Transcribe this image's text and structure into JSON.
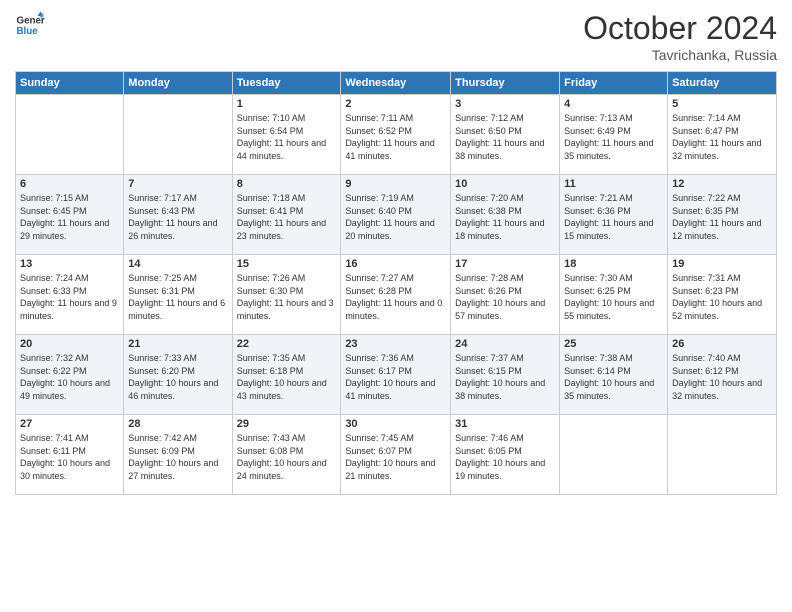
{
  "logo": {
    "line1": "General",
    "line2": "Blue"
  },
  "title": "October 2024",
  "subtitle": "Tavrichanka, Russia",
  "days_of_week": [
    "Sunday",
    "Monday",
    "Tuesday",
    "Wednesday",
    "Thursday",
    "Friday",
    "Saturday"
  ],
  "weeks": [
    [
      {
        "day": "",
        "sunrise": "",
        "sunset": "",
        "daylight": ""
      },
      {
        "day": "",
        "sunrise": "",
        "sunset": "",
        "daylight": ""
      },
      {
        "day": "1",
        "sunrise": "Sunrise: 7:10 AM",
        "sunset": "Sunset: 6:54 PM",
        "daylight": "Daylight: 11 hours and 44 minutes."
      },
      {
        "day": "2",
        "sunrise": "Sunrise: 7:11 AM",
        "sunset": "Sunset: 6:52 PM",
        "daylight": "Daylight: 11 hours and 41 minutes."
      },
      {
        "day": "3",
        "sunrise": "Sunrise: 7:12 AM",
        "sunset": "Sunset: 6:50 PM",
        "daylight": "Daylight: 11 hours and 38 minutes."
      },
      {
        "day": "4",
        "sunrise": "Sunrise: 7:13 AM",
        "sunset": "Sunset: 6:49 PM",
        "daylight": "Daylight: 11 hours and 35 minutes."
      },
      {
        "day": "5",
        "sunrise": "Sunrise: 7:14 AM",
        "sunset": "Sunset: 6:47 PM",
        "daylight": "Daylight: 11 hours and 32 minutes."
      }
    ],
    [
      {
        "day": "6",
        "sunrise": "Sunrise: 7:15 AM",
        "sunset": "Sunset: 6:45 PM",
        "daylight": "Daylight: 11 hours and 29 minutes."
      },
      {
        "day": "7",
        "sunrise": "Sunrise: 7:17 AM",
        "sunset": "Sunset: 6:43 PM",
        "daylight": "Daylight: 11 hours and 26 minutes."
      },
      {
        "day": "8",
        "sunrise": "Sunrise: 7:18 AM",
        "sunset": "Sunset: 6:41 PM",
        "daylight": "Daylight: 11 hours and 23 minutes."
      },
      {
        "day": "9",
        "sunrise": "Sunrise: 7:19 AM",
        "sunset": "Sunset: 6:40 PM",
        "daylight": "Daylight: 11 hours and 20 minutes."
      },
      {
        "day": "10",
        "sunrise": "Sunrise: 7:20 AM",
        "sunset": "Sunset: 6:38 PM",
        "daylight": "Daylight: 11 hours and 18 minutes."
      },
      {
        "day": "11",
        "sunrise": "Sunrise: 7:21 AM",
        "sunset": "Sunset: 6:36 PM",
        "daylight": "Daylight: 11 hours and 15 minutes."
      },
      {
        "day": "12",
        "sunrise": "Sunrise: 7:22 AM",
        "sunset": "Sunset: 6:35 PM",
        "daylight": "Daylight: 11 hours and 12 minutes."
      }
    ],
    [
      {
        "day": "13",
        "sunrise": "Sunrise: 7:24 AM",
        "sunset": "Sunset: 6:33 PM",
        "daylight": "Daylight: 11 hours and 9 minutes."
      },
      {
        "day": "14",
        "sunrise": "Sunrise: 7:25 AM",
        "sunset": "Sunset: 6:31 PM",
        "daylight": "Daylight: 11 hours and 6 minutes."
      },
      {
        "day": "15",
        "sunrise": "Sunrise: 7:26 AM",
        "sunset": "Sunset: 6:30 PM",
        "daylight": "Daylight: 11 hours and 3 minutes."
      },
      {
        "day": "16",
        "sunrise": "Sunrise: 7:27 AM",
        "sunset": "Sunset: 6:28 PM",
        "daylight": "Daylight: 11 hours and 0 minutes."
      },
      {
        "day": "17",
        "sunrise": "Sunrise: 7:28 AM",
        "sunset": "Sunset: 6:26 PM",
        "daylight": "Daylight: 10 hours and 57 minutes."
      },
      {
        "day": "18",
        "sunrise": "Sunrise: 7:30 AM",
        "sunset": "Sunset: 6:25 PM",
        "daylight": "Daylight: 10 hours and 55 minutes."
      },
      {
        "day": "19",
        "sunrise": "Sunrise: 7:31 AM",
        "sunset": "Sunset: 6:23 PM",
        "daylight": "Daylight: 10 hours and 52 minutes."
      }
    ],
    [
      {
        "day": "20",
        "sunrise": "Sunrise: 7:32 AM",
        "sunset": "Sunset: 6:22 PM",
        "daylight": "Daylight: 10 hours and 49 minutes."
      },
      {
        "day": "21",
        "sunrise": "Sunrise: 7:33 AM",
        "sunset": "Sunset: 6:20 PM",
        "daylight": "Daylight: 10 hours and 46 minutes."
      },
      {
        "day": "22",
        "sunrise": "Sunrise: 7:35 AM",
        "sunset": "Sunset: 6:18 PM",
        "daylight": "Daylight: 10 hours and 43 minutes."
      },
      {
        "day": "23",
        "sunrise": "Sunrise: 7:36 AM",
        "sunset": "Sunset: 6:17 PM",
        "daylight": "Daylight: 10 hours and 41 minutes."
      },
      {
        "day": "24",
        "sunrise": "Sunrise: 7:37 AM",
        "sunset": "Sunset: 6:15 PM",
        "daylight": "Daylight: 10 hours and 38 minutes."
      },
      {
        "day": "25",
        "sunrise": "Sunrise: 7:38 AM",
        "sunset": "Sunset: 6:14 PM",
        "daylight": "Daylight: 10 hours and 35 minutes."
      },
      {
        "day": "26",
        "sunrise": "Sunrise: 7:40 AM",
        "sunset": "Sunset: 6:12 PM",
        "daylight": "Daylight: 10 hours and 32 minutes."
      }
    ],
    [
      {
        "day": "27",
        "sunrise": "Sunrise: 7:41 AM",
        "sunset": "Sunset: 6:11 PM",
        "daylight": "Daylight: 10 hours and 30 minutes."
      },
      {
        "day": "28",
        "sunrise": "Sunrise: 7:42 AM",
        "sunset": "Sunset: 6:09 PM",
        "daylight": "Daylight: 10 hours and 27 minutes."
      },
      {
        "day": "29",
        "sunrise": "Sunrise: 7:43 AM",
        "sunset": "Sunset: 6:08 PM",
        "daylight": "Daylight: 10 hours and 24 minutes."
      },
      {
        "day": "30",
        "sunrise": "Sunrise: 7:45 AM",
        "sunset": "Sunset: 6:07 PM",
        "daylight": "Daylight: 10 hours and 21 minutes."
      },
      {
        "day": "31",
        "sunrise": "Sunrise: 7:46 AM",
        "sunset": "Sunset: 6:05 PM",
        "daylight": "Daylight: 10 hours and 19 minutes."
      },
      {
        "day": "",
        "sunrise": "",
        "sunset": "",
        "daylight": ""
      },
      {
        "day": "",
        "sunrise": "",
        "sunset": "",
        "daylight": ""
      }
    ]
  ]
}
